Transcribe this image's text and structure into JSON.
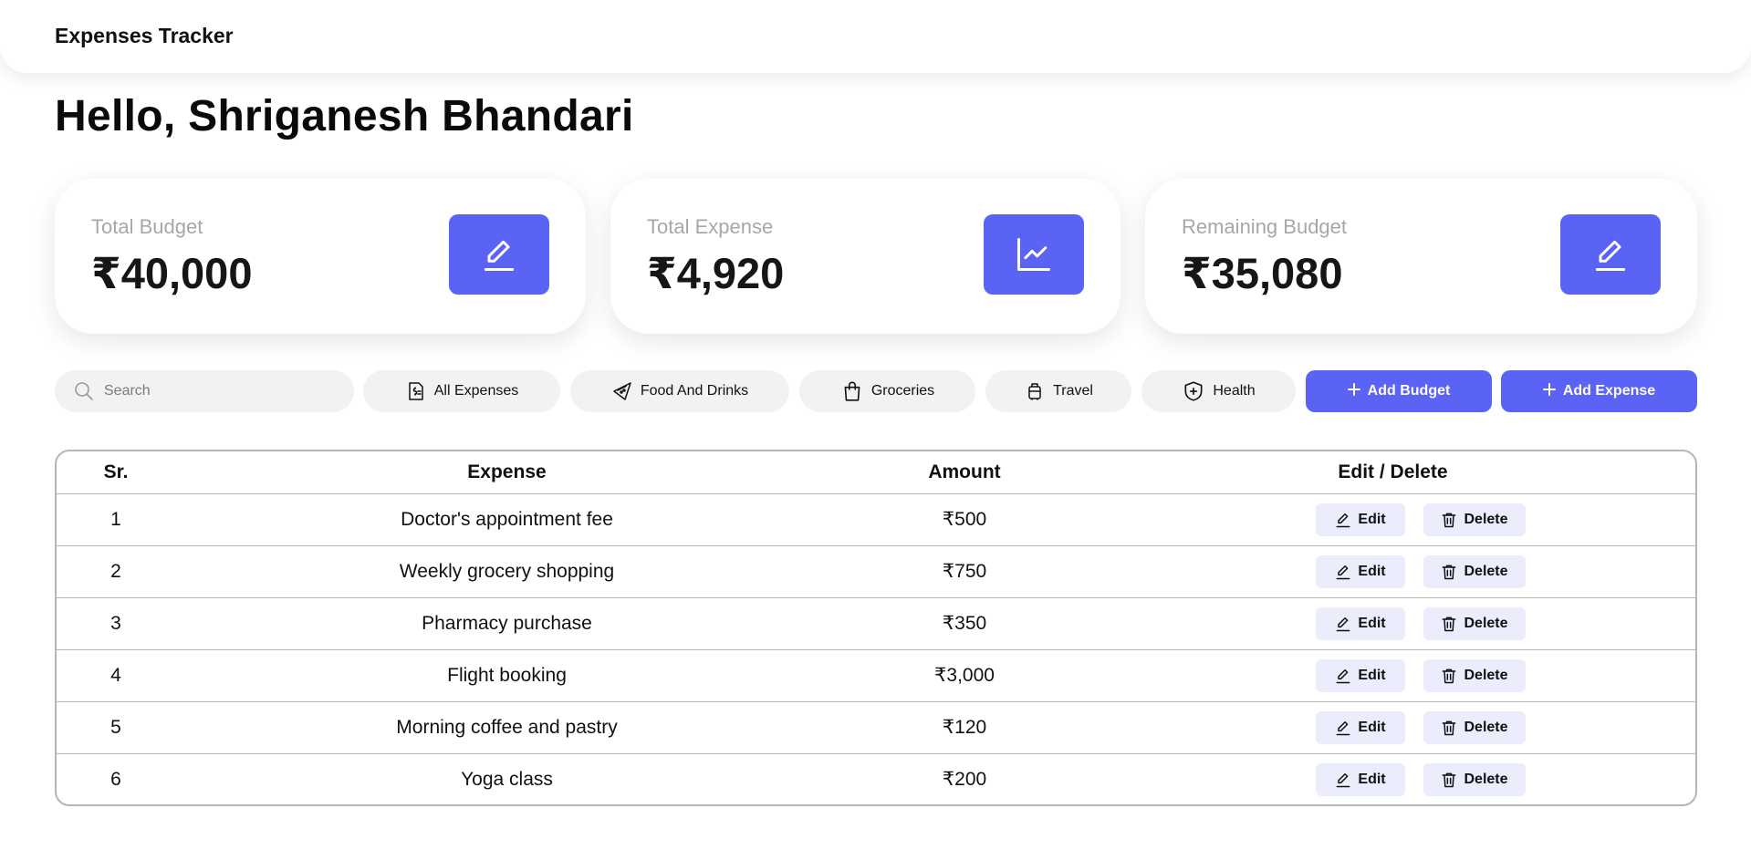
{
  "brand": "Expenses Tracker",
  "greeting": "Hello, Shriganesh Bhandari",
  "cards": [
    {
      "label": "Total Budget",
      "value": "₹40,000",
      "icon": "pencil-icon"
    },
    {
      "label": "Total Expense",
      "value": "₹4,920",
      "icon": "line-chart-icon"
    },
    {
      "label": "Remaining Budget",
      "value": "₹35,080",
      "icon": "pencil-icon"
    }
  ],
  "search": {
    "placeholder": "Search"
  },
  "filters": [
    {
      "label": "All Expenses",
      "icon": "receipt-icon"
    },
    {
      "label": "Food And Drinks",
      "icon": "pizza-icon"
    },
    {
      "label": "Groceries",
      "icon": "shopping-bag-icon"
    },
    {
      "label": "Travel",
      "icon": "luggage-icon"
    },
    {
      "label": "Health",
      "icon": "shield-plus-icon"
    }
  ],
  "actions": {
    "add_budget": "Add Budget",
    "add_expense": "Add Expense"
  },
  "table": {
    "headers": [
      "Sr.",
      "Expense",
      "Amount",
      "Edit / Delete"
    ],
    "rows": [
      {
        "sr": "1",
        "expense": "Doctor's appointment fee",
        "amount": "₹500"
      },
      {
        "sr": "2",
        "expense": "Weekly grocery shopping",
        "amount": "₹750"
      },
      {
        "sr": "3",
        "expense": "Pharmacy purchase",
        "amount": "₹350"
      },
      {
        "sr": "4",
        "expense": "Flight booking",
        "amount": "₹3,000"
      },
      {
        "sr": "5",
        "expense": "Morning coffee and pastry",
        "amount": "₹120"
      },
      {
        "sr": "6",
        "expense": "Yoga class",
        "amount": "₹200"
      }
    ],
    "edit_label": "Edit",
    "delete_label": "Delete"
  },
  "colors": {
    "accent": "#5b63f5",
    "chip_bg": "#f2f2f2",
    "action_bg": "#ecedfc"
  }
}
